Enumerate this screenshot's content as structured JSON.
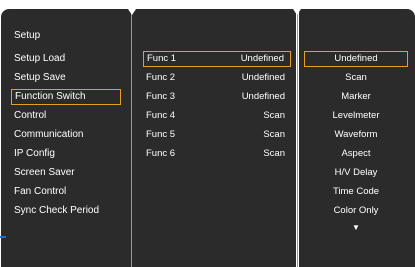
{
  "setup_menu": {
    "title": "Setup",
    "items": [
      {
        "label": "Setup Load",
        "selected": false
      },
      {
        "label": "Setup Save",
        "selected": false
      },
      {
        "label": "Function Switch",
        "selected": true
      },
      {
        "label": "Control",
        "selected": false
      },
      {
        "label": "Communication",
        "selected": false
      },
      {
        "label": "IP Config",
        "selected": false
      },
      {
        "label": "Screen Saver",
        "selected": false
      },
      {
        "label": "Fan Control",
        "selected": false
      },
      {
        "label": "Sync Check Period",
        "selected": false
      }
    ]
  },
  "functions": [
    {
      "name": "Func 1",
      "value": "Undefined",
      "selected": true
    },
    {
      "name": "Func 2",
      "value": "Undefined",
      "selected": false
    },
    {
      "name": "Func 3",
      "value": "Undefined",
      "selected": false
    },
    {
      "name": "Func 4",
      "value": "Scan",
      "selected": false
    },
    {
      "name": "Func 5",
      "value": "Scan",
      "selected": false
    },
    {
      "name": "Func 6",
      "value": "Scan",
      "selected": false
    }
  ],
  "options": {
    "items": [
      {
        "label": "Undefined",
        "selected": true
      },
      {
        "label": "Scan",
        "selected": false
      },
      {
        "label": "Marker",
        "selected": false
      },
      {
        "label": "Levelmeter",
        "selected": false
      },
      {
        "label": "Waveform",
        "selected": false
      },
      {
        "label": "Aspect",
        "selected": false
      },
      {
        "label": "H/V Delay",
        "selected": false
      },
      {
        "label": "Time Code",
        "selected": false
      },
      {
        "label": "Color Only",
        "selected": false
      }
    ],
    "more_indicator": "▼"
  },
  "colors": {
    "panel_bg": "#2b2b2b",
    "selection_border": "#e6a020",
    "text": "#ffffff",
    "accent_edge": "#1e6fd0"
  }
}
